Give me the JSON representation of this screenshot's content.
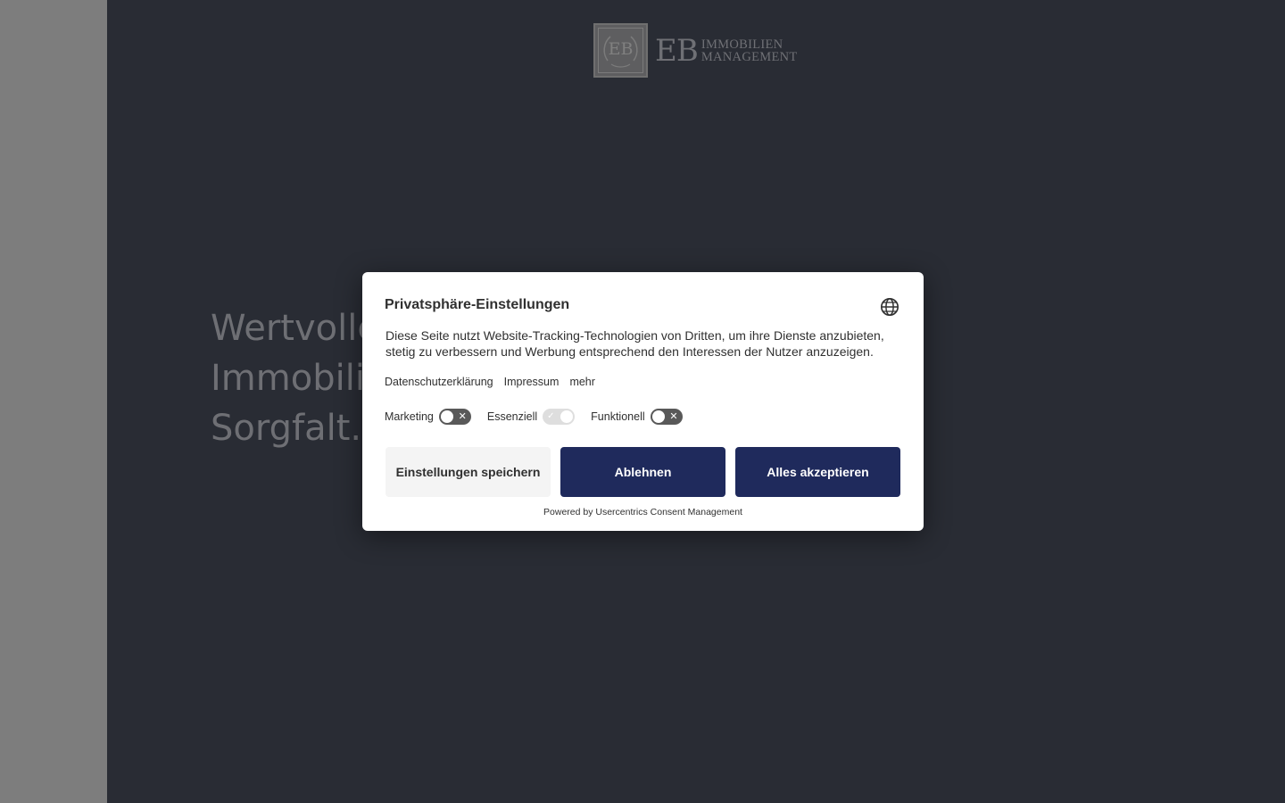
{
  "brand": {
    "monogram": "EB",
    "eb": "EB",
    "line1": "IMMOBILIEN",
    "line2": "MANAGEMENT"
  },
  "hero": {
    "line1": "Wertvolle",
    "line2": "Immobilien",
    "line3": "Sorgfalt."
  },
  "consent": {
    "title": "Privatsphäre-Einstellungen",
    "globe_icon": "globe-icon",
    "description": "Diese Seite nutzt Website-Tracking-Technologien von Dritten, um ihre Dienste anzubieten, stetig zu verbessern und Werbung entsprechend den Interessen der Nutzer anzuzeigen.",
    "links": [
      "Datenschutzerklärung",
      "Impressum",
      "mehr"
    ],
    "toggles": [
      {
        "label": "Marketing",
        "state": "off"
      },
      {
        "label": "Essenziell",
        "state": "on-disabled"
      },
      {
        "label": "Funktionell",
        "state": "off"
      }
    ],
    "buttons": {
      "save": "Einstellungen speichern",
      "deny": "Ablehnen",
      "accept": "Alles akzeptieren"
    },
    "powered_by": "Powered by Usercentrics Consent Management"
  },
  "colors": {
    "background": "#292c34",
    "sidebar": "#7d7d7d",
    "button_primary": "#1f2a5c",
    "button_secondary": "#f4f4f4"
  }
}
